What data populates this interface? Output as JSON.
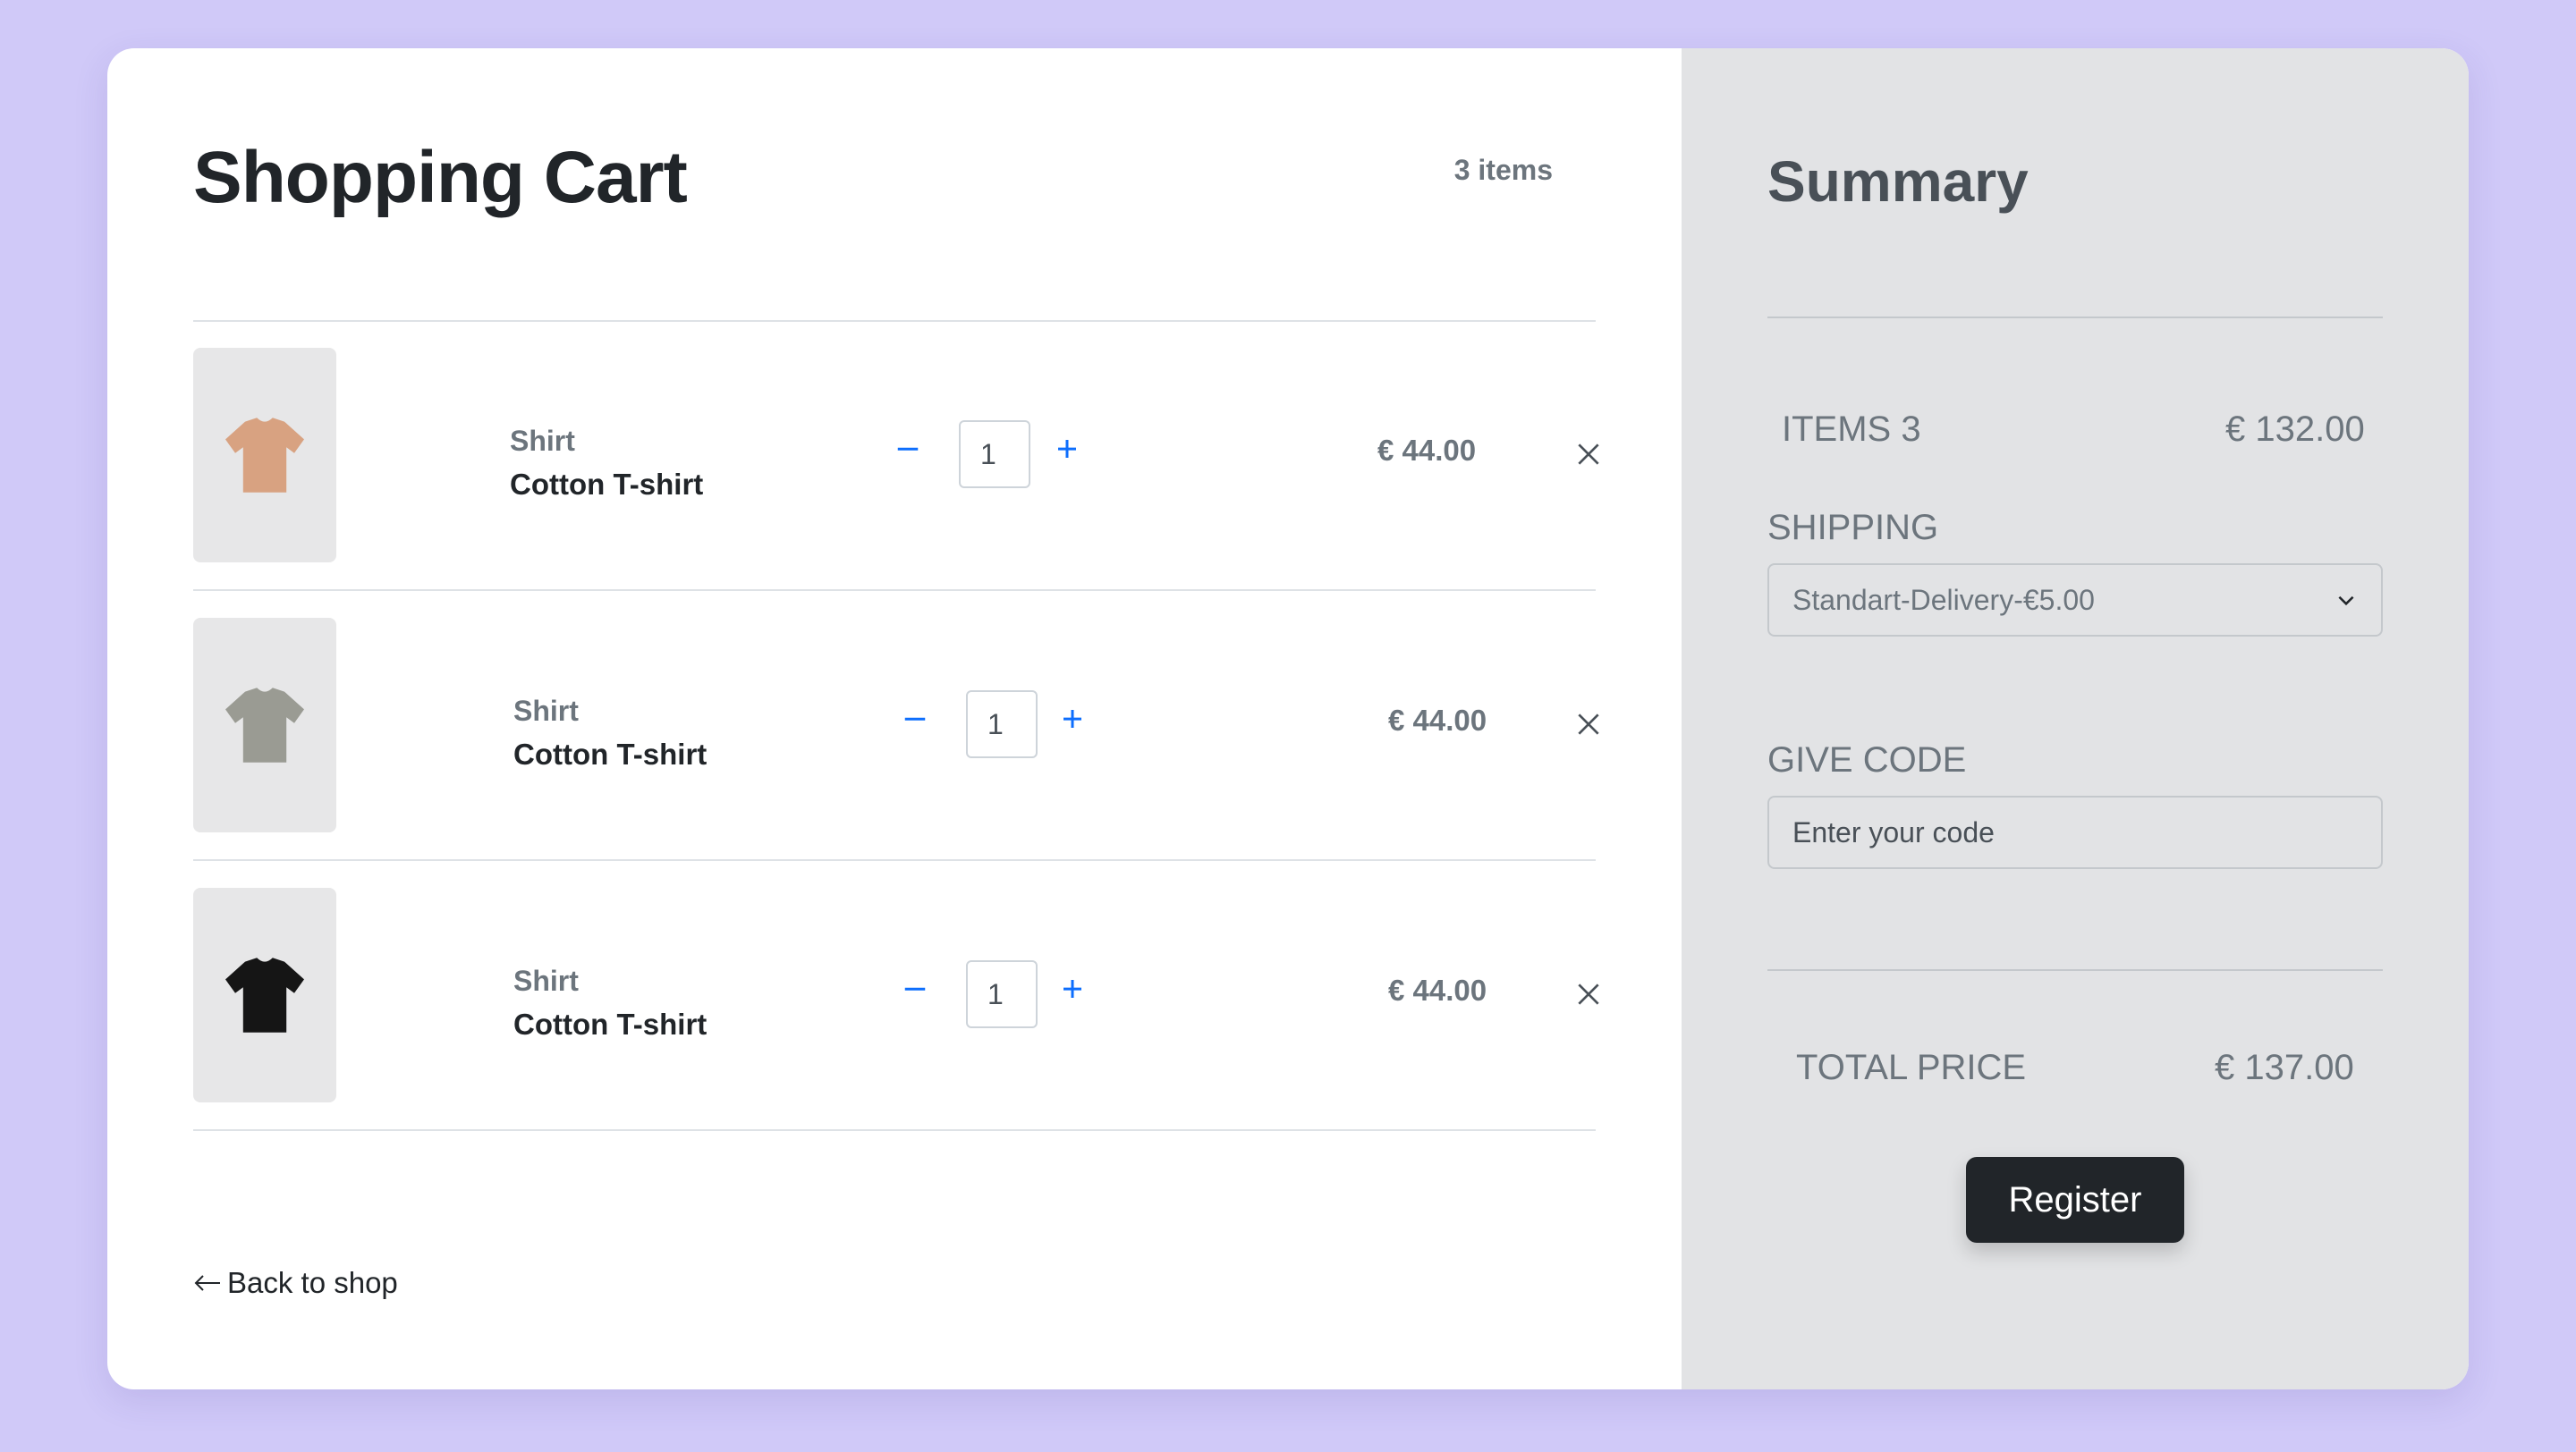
{
  "cart": {
    "title": "Shopping Cart",
    "items_count": "3 items",
    "back_label": "Back to shop",
    "items": [
      {
        "category": "Shirt",
        "name": "Cotton T-shirt",
        "quantity": "1",
        "price": "€ 44.00",
        "shirt_color": "#d8a281"
      },
      {
        "category": "Shirt",
        "name": "Cotton T-shirt",
        "quantity": "1",
        "price": "€ 44.00",
        "shirt_color": "#9a9b93"
      },
      {
        "category": "Shirt",
        "name": "Cotton T-shirt",
        "quantity": "1",
        "price": "€ 44.00",
        "shirt_color": "#151515"
      }
    ]
  },
  "summary": {
    "title": "Summary",
    "items_label": "ITEMS 3",
    "items_total": "€ 132.00",
    "shipping_label": "SHIPPING",
    "shipping_selected": "Standart-Delivery-€5.00",
    "code_label": "GIVE CODE",
    "code_placeholder": "Enter your code",
    "total_label": "TOTAL PRICE",
    "total_value": "€ 137.00",
    "register_label": "Register"
  },
  "colors": {
    "background": "#d0c9f8",
    "summary_panel": "#e2e3e5",
    "accent_blue": "#0d6efd",
    "button_dark": "#212529"
  },
  "icons": {
    "decrease": "minus-icon",
    "increase": "plus-icon",
    "remove": "close-icon",
    "back": "arrow-left-icon",
    "select": "chevron-down-icon"
  }
}
